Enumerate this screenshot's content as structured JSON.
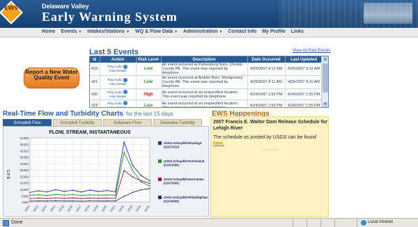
{
  "header": {
    "logo_text": "EWS",
    "org_name": "Delaware Valley",
    "system_name": "Early Warning System"
  },
  "nav": [
    {
      "label": "Home",
      "has_menu": false
    },
    {
      "label": "Events",
      "has_menu": true
    },
    {
      "label": "Intakes/Stations",
      "has_menu": true
    },
    {
      "label": "WQ & Flow Data",
      "has_menu": true
    },
    {
      "label": "Administration",
      "has_menu": true
    },
    {
      "label": "Contact Info",
      "has_menu": false
    },
    {
      "label": "My Profile",
      "has_menu": false
    },
    {
      "label": "Links",
      "has_menu": false
    }
  ],
  "report_button": "Report a New Water Quality Event",
  "events": {
    "title": "Last 5 Events",
    "view_all": "View All Past Events",
    "columns": [
      "Id",
      "Action",
      "Risk Level",
      "Description",
      "Date Occurred",
      "Last Updated"
    ],
    "action_labels": {
      "audio": "Play Audio",
      "details": "View Details"
    },
    "rows": [
      {
        "id": "422",
        "risk": "Low",
        "risk_color": "#2c8c2c",
        "desc": "An event occurred at Parkesburg Boro, Chester County PA. This event was reported by telephone.",
        "occurred": "4/25/2007 9:12 AM",
        "updated": "4/25/2007 9:12 AM"
      },
      {
        "id": "421",
        "risk": "Low",
        "risk_color": "#2c8c2c",
        "desc": "An event occurred at Ambler Boro, Montgomery County PA. This event was reported by telephone.",
        "occurred": "4/25/2007 9:11 AM",
        "updated": "4/25/2007 9:11 AM"
      },
      {
        "id": "420",
        "risk": "High",
        "risk_color": "#cc1111",
        "desc": "An event occurred at an unspecified location. This event was reported by telephone.",
        "occurred": "4/24/2007 1:55 PM",
        "updated": "4/24/2007 1:55 PM"
      },
      {
        "id": "419",
        "risk": "Low",
        "risk_color": "#2c8c2c",
        "desc": "An event occurred at an unspecified location. This event was reported by telephone.",
        "occurred": "4/24/2007 1:55 PM",
        "updated": "4/24/2007 1:55 PM"
      }
    ]
  },
  "flow": {
    "title": "Real-Time Flow and Turbidity Charts",
    "subtitle": "for the last 15 days",
    "tabs": [
      {
        "label": "Schuylkill Flow",
        "active": true
      },
      {
        "label": "Schuylkill Turbidity",
        "active": false
      },
      {
        "label": "Delaware Flow",
        "active": false
      },
      {
        "label": "Delaware Turbidity",
        "active": false
      }
    ]
  },
  "chart_data": {
    "type": "line",
    "title": "FLOW, STREAM, INSTANTANEOUS",
    "ylabel": "C F S",
    "xlabel": "",
    "ylim": [
      1600,
      51300
    ],
    "yticks": [
      1600,
      6300,
      11200,
      16370,
      21360,
      26350,
      31340,
      36330,
      41320,
      46310,
      51300
    ],
    "xticks": [
      "04/11",
      "04/12",
      "04/13",
      "04/14",
      "04/15",
      "04/16",
      "04/17",
      "04/18",
      "04/19",
      "04/20",
      "04/21",
      "04/22",
      "04/23",
      "04/24",
      "04/25"
    ],
    "series": [
      {
        "name": "USGS-Schuylkill-Reading3 (01471510)",
        "color": "#1f2f9c",
        "values": [
          9000,
          10200,
          9400,
          11000,
          9800,
          10600,
          9300,
          10800,
          9700,
          10400,
          9500,
          48000,
          30000,
          22000,
          18000
        ]
      },
      {
        "name": "USGS-Schuylkill-Pottstown2 (01472000)",
        "color": "#2c8c2c",
        "values": [
          6800,
          7200,
          6600,
          7400,
          6900,
          7300,
          6700,
          7100,
          6900,
          7000,
          6800,
          40000,
          26000,
          17000,
          14000
        ]
      },
      {
        "name": "USGS-Schuylkill-Norristown (01473500)",
        "color": "#8b1a3b",
        "values": [
          4200,
          4600,
          4300,
          4800,
          4400,
          4700,
          4300,
          4600,
          4500,
          4600,
          4400,
          26000,
          21000,
          18000,
          16000
        ]
      },
      {
        "name": "USGS-Schuylkill-Philadelphia4 (01474500)",
        "color": "#2b2b5a",
        "values": [
          2200,
          2400,
          2300,
          2500,
          2300,
          2400,
          2200,
          2400,
          2300,
          2400,
          2300,
          6000,
          9000,
          11000,
          12000
        ]
      }
    ]
  },
  "happenings": {
    "title": "EWS Happenings",
    "headline": "2007 Francis E. Walter Dam Release Schedule for Lehigh River",
    "body": "The schedule as posted by USGS can be found",
    "link": "here.",
    "dots": "........"
  },
  "status": {
    "left": "Done",
    "zone": "Local intranet"
  }
}
